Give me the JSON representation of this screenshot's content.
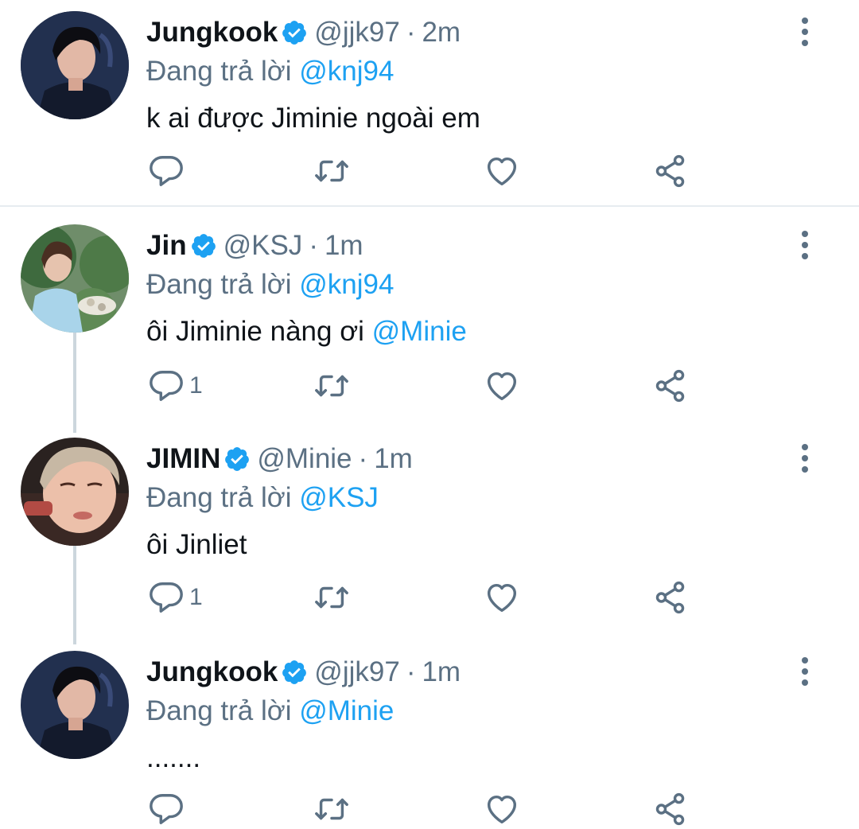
{
  "tweets": [
    {
      "name": "Jungkook",
      "handle": "@jjk97",
      "sep": "·",
      "time": "2m",
      "reply_prefix": "Đang trả lời ",
      "reply_to": "@knj94",
      "text": "k ai được Jiminie ngoài em",
      "mention": "",
      "reply_count": "",
      "avatar": "jungkook-avatar"
    },
    {
      "name": "Jin",
      "handle": "@KSJ",
      "sep": "·",
      "time": "1m",
      "reply_prefix": "Đang trả lời ",
      "reply_to": "@knj94",
      "text": "ôi Jiminie nàng ơi ",
      "mention": "@Minie",
      "reply_count": "1",
      "avatar": "jin-avatar"
    },
    {
      "name": "JIMIN",
      "handle": "@Minie",
      "sep": "·",
      "time": "1m",
      "reply_prefix": "Đang trả lời ",
      "reply_to": "@KSJ",
      "text": "ôi Jinliet",
      "mention": "",
      "reply_count": "1",
      "avatar": "jimin-avatar"
    },
    {
      "name": "Jungkook",
      "handle": "@jjk97",
      "sep": "·",
      "time": "1m",
      "reply_prefix": "Đang trả lời ",
      "reply_to": "@Minie",
      "text": ".......",
      "mention": "",
      "reply_count": "",
      "avatar": "jungkook-avatar"
    }
  ],
  "colors": {
    "accent": "#1da1f2",
    "secondary_text": "#5b7083",
    "icon": "#5b7083",
    "divider": "#e6ecf0"
  },
  "icons": {
    "reply": "reply-icon",
    "retweet": "retweet-icon",
    "like": "heart-icon",
    "share": "share-icon",
    "more": "more-vertical-icon",
    "verified": "verified-badge-icon"
  }
}
